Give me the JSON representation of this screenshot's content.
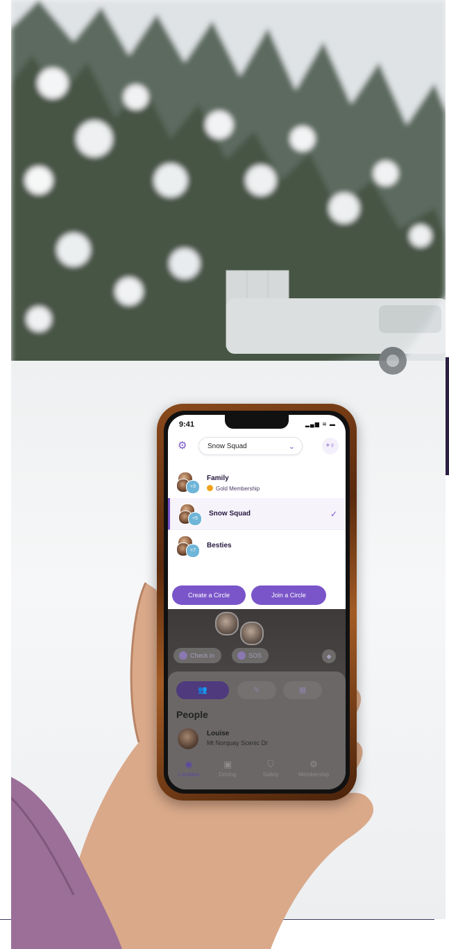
{
  "status_bar": {
    "time": "9:41",
    "icons": "▂▄▆ ≋ ▬"
  },
  "header": {
    "settings_icon": "gear-icon",
    "selected_circle": "Snow Squad",
    "add_member_icon": "add-person-icon",
    "add_member_label": "+♀"
  },
  "circles": [
    {
      "name": "Family",
      "badge": "Gold Membership",
      "count": "+3",
      "selected": false
    },
    {
      "name": "Snow Squad",
      "badge": "",
      "count": "+5",
      "selected": true
    },
    {
      "name": "Besties",
      "badge": "",
      "count": "+7",
      "selected": false
    }
  ],
  "actions": {
    "create": "Create a Circle",
    "join": "Join a Circle"
  },
  "map": {
    "checkin": "Check in",
    "sos": "SOS"
  },
  "sheet": {
    "segments": [
      "👥",
      "✎",
      "▦"
    ],
    "people_title": "People",
    "person": {
      "name": "Louise",
      "location": "Mt Norquay Scenic Dr"
    }
  },
  "tabs": [
    {
      "label": "Location",
      "icon": "◉",
      "active": true
    },
    {
      "label": "Driving",
      "icon": "▣",
      "active": false
    },
    {
      "label": "Safety",
      "icon": "⛉",
      "active": false
    },
    {
      "label": "Membership",
      "icon": "⚙",
      "active": false
    }
  ],
  "colors": {
    "accent": "#7a55c9",
    "gold": "#f2a31b",
    "bar": "#2b1f44"
  }
}
